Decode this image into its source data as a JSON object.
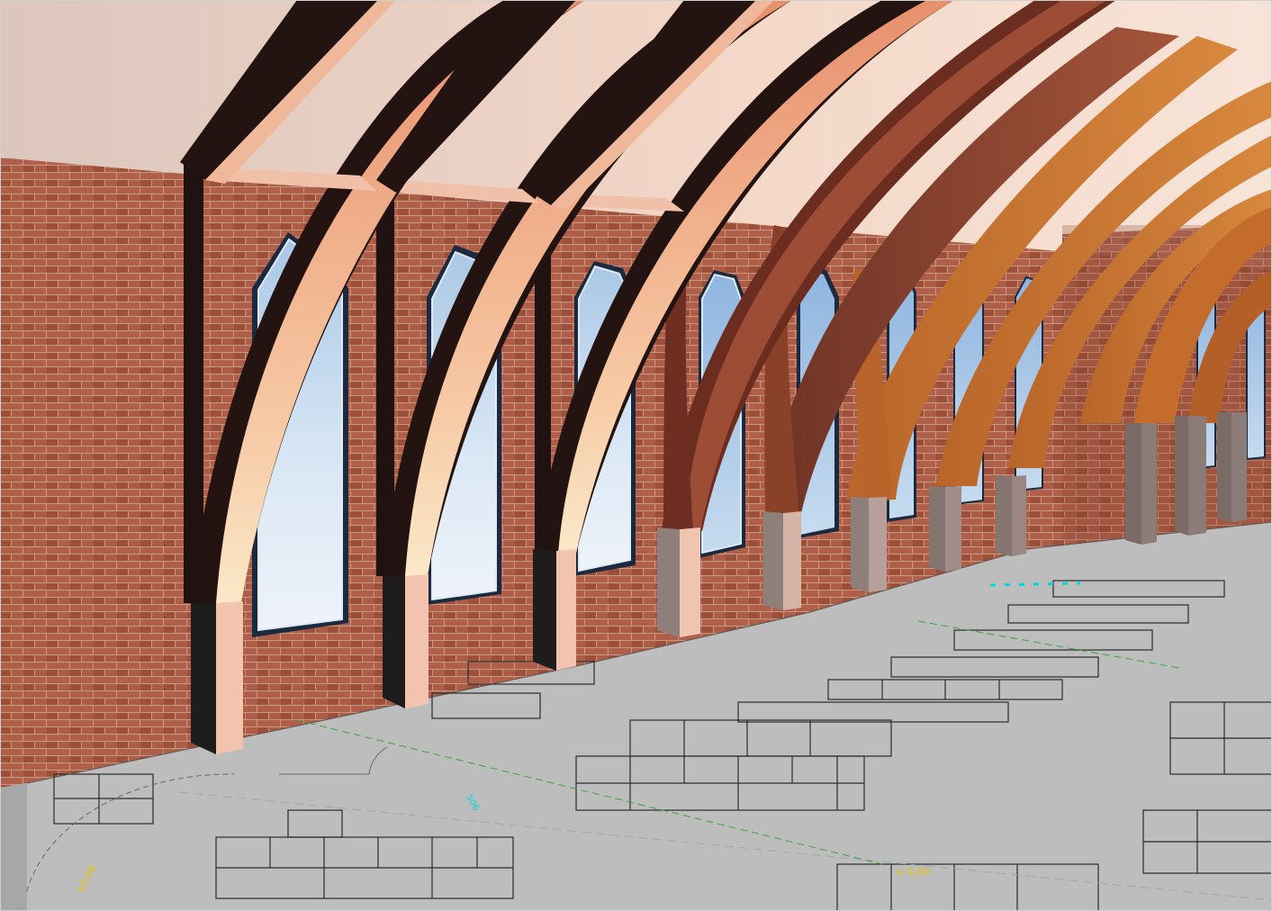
{
  "scene": {
    "kind": "3D architectural render",
    "colors": {
      "ceiling": "#f4d6c6",
      "brick": "#a9563f",
      "mortar": "#c99a82",
      "floor": "#bdbdbd",
      "glass": "#bcd6ee",
      "beam_dark": "#2a1814",
      "beam_light": "#f3b48e",
      "beam_wood": "#c7722f",
      "plinth_dark": "#1e1c1c",
      "plinth_light": "#f2c4b0",
      "plinth_grey": "#8f7f7a",
      "annotation_yellow": "#e8c200",
      "annotation_cyan": "#00d8d8"
    },
    "annotations": {
      "level_left": "±0,00",
      "level_center": "± 0,00",
      "dimension_label": "506"
    }
  }
}
